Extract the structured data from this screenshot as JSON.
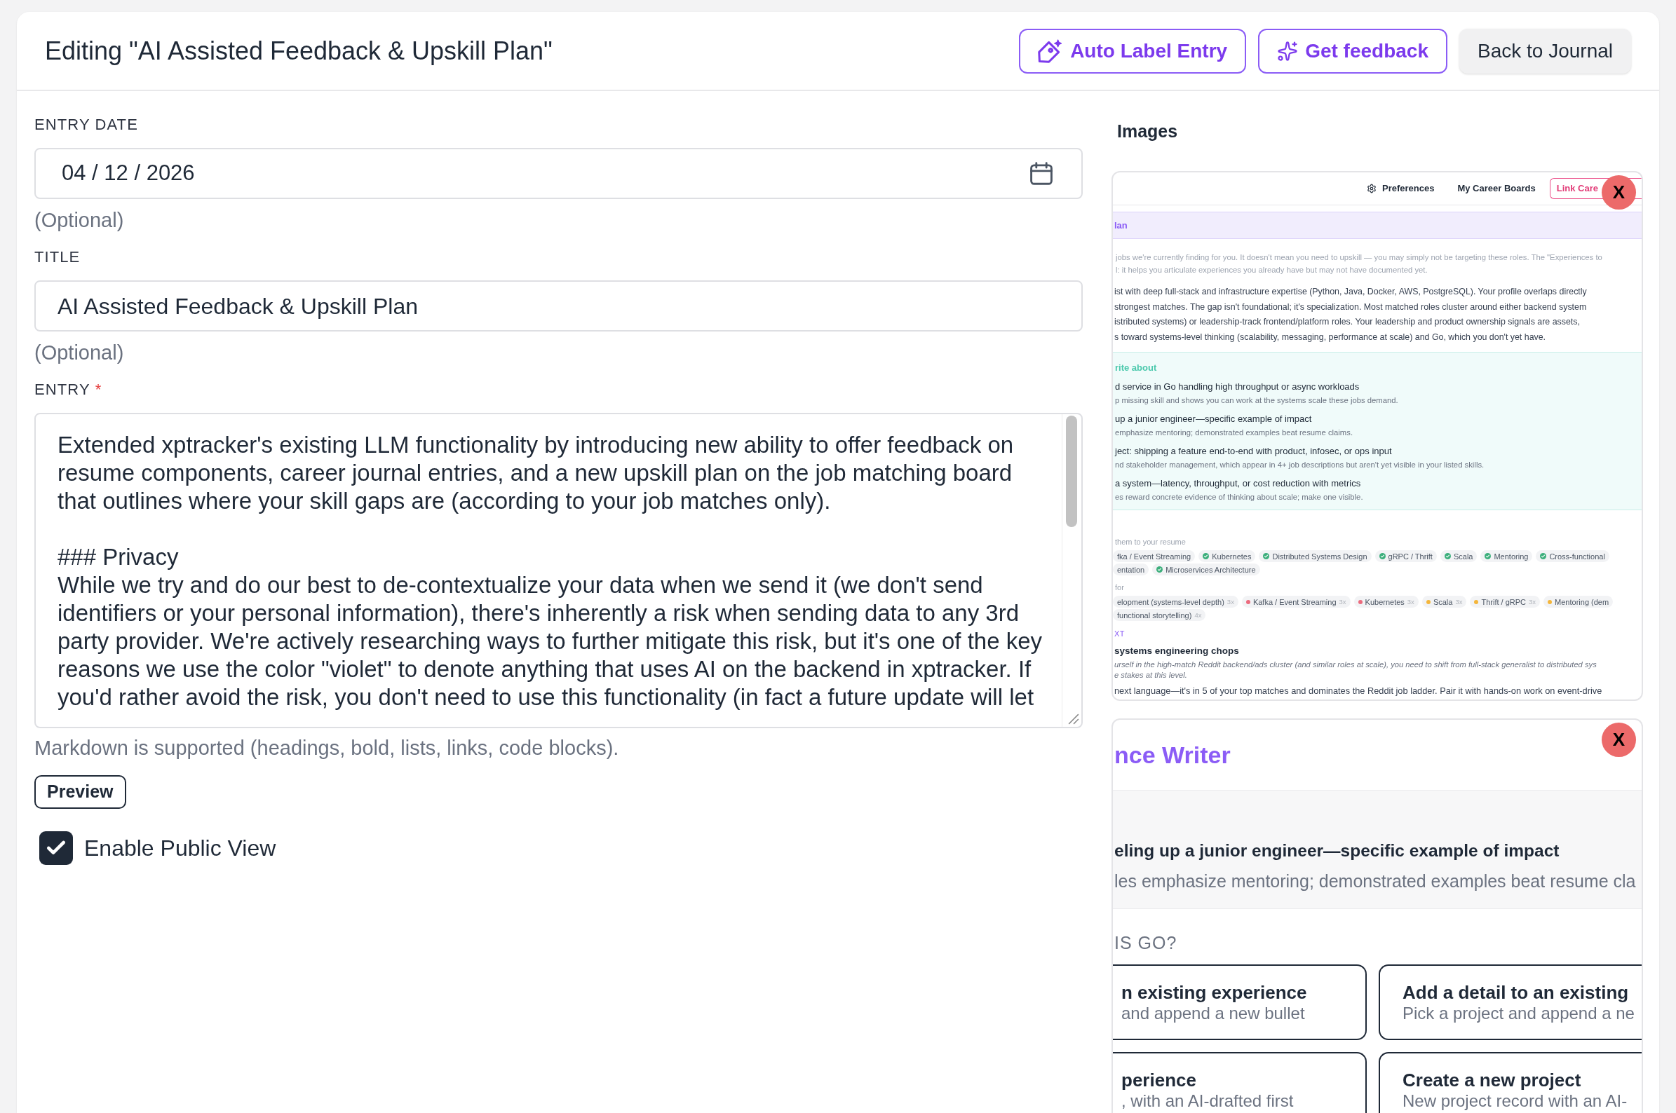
{
  "header": {
    "title": "Editing \"AI Assisted Feedback & Upskill Plan\"",
    "buttons": [
      {
        "kind": "label",
        "label": "Auto Label Entry"
      },
      {
        "kind": "feedback",
        "label": "Get feedback"
      },
      {
        "kind": "back",
        "label": "Back to Journal"
      }
    ]
  },
  "form": {
    "fields": [
      {
        "kind": "date",
        "label": "ENTRY DATE",
        "value": "04 / 12 / 2026",
        "hint": "(Optional)"
      },
      {
        "kind": "text",
        "label": "TITLE",
        "value": "AI Assisted Feedback & Upskill Plan",
        "hint": "(Optional)"
      },
      {
        "kind": "markdown",
        "label": "ENTRY",
        "required_mark": "*",
        "paragraphs": [
          [
            "Extended xptracker's existing LLM functionality by introducing new ability to offer feedback on",
            "resume components, career journal entries, and a new upskill plan on the job matching board",
            "that outlines where your skill gaps are (according to your job matches only)."
          ],
          [
            "### Privacy",
            "While we try and do our best to de-contextualize your data when we send it (we don't send",
            "identifiers or your personal information), there's inherently a risk when sending data to any 3rd",
            "party provider. We're actively researching ways to further mitigate this risk, but it's one of the key",
            "reasons we use the color \"violet\" to denote anything that uses AI on the backend in xptracker. If",
            "you'd rather avoid the risk, you don't need to use this functionality (in fact a future update will let"
          ]
        ],
        "hint": "Markdown is supported (headings, bold, lists, links, code blocks)."
      }
    ],
    "preview_button": "Preview",
    "public_view": {
      "label": "Enable Public View",
      "checked": true
    }
  },
  "images": {
    "title": "Images",
    "items": [
      {
        "kind": "upskill_plan",
        "remove_label": "X",
        "nav": [
          {
            "kind": "settings",
            "label": "Preferences"
          },
          {
            "kind": "link",
            "label": "My Career Boards"
          },
          {
            "kind": "outline",
            "label": "Link Care"
          }
        ],
        "banner": "lan",
        "intro_lines": [
          "jobs we're currently finding for you. It doesn't mean you need to upskill — you may simply not be targeting these roles. The \"Experiences to",
          "l: it helps you articulate experiences you already have but may not have documented yet."
        ],
        "summary_lines": [
          "ist with deep full-stack and infrastructure expertise (Python, Java, Docker, AWS, PostgreSQL). Your profile overlaps directly",
          "strongest matches. The gap isn't foundational; it's specialization. Most matched roles cluster around either backend system",
          "istributed systems) or leadership-track frontend/platform roles. Your leadership and product ownership signals are assets,",
          "s toward systems-level thinking (scalability, messaging, performance at scale) and Go, which you don't yet have."
        ],
        "write_about": {
          "heading": "rite about",
          "items": [
            {
              "title": "d service in Go handling high throughput or async workloads",
              "description": "p missing skill and shows you can work at the systems scale these jobs demand."
            },
            {
              "title": "up a junior engineer—specific example of impact",
              "description": "emphasize mentoring; demonstrated examples beat resume claims."
            },
            {
              "title": "ject: shipping a feature end-to-end with product, infosec, or ops input",
              "description": "nd stakeholder management, which appear in 4+ job descriptions but aren't yet visible in your listed skills."
            },
            {
              "title": "a system—latency, throughput, or cost reduction with metrics",
              "description": "es reward concrete evidence of thinking about scale; make one visible."
            }
          ]
        },
        "tag_groups": [
          {
            "heading": "them to your resume",
            "rows": [
              [
                {
                  "kind": "plain",
                  "label": "fka / Event Streaming"
                },
                {
                  "kind": "check",
                  "label": "Kubernetes"
                },
                {
                  "kind": "check",
                  "label": "Distributed Systems Design"
                },
                {
                  "kind": "check",
                  "label": "gRPC / Thrift"
                },
                {
                  "kind": "check",
                  "label": "Scala"
                },
                {
                  "kind": "check",
                  "label": "Mentoring"
                },
                {
                  "kind": "check",
                  "label": "Cross-functional"
                }
              ],
              [
                {
                  "kind": "plain",
                  "label": "entation"
                },
                {
                  "kind": "check",
                  "label": "Microservices Architecture"
                }
              ]
            ]
          },
          {
            "heading": "for",
            "rows": [
              [
                {
                  "kind": "plain",
                  "label": "elopment (systems-level depth)",
                  "count": "3x"
                },
                {
                  "kind": "dot",
                  "label": "Kafka / Event Streaming",
                  "count": "3x",
                  "color": "#ec6b7e"
                },
                {
                  "kind": "dot",
                  "label": "Kubernetes",
                  "count": "3x",
                  "color": "#ec6b7e"
                },
                {
                  "kind": "dot",
                  "label": "Scala",
                  "count": "3x",
                  "color": "#f4b63c"
                },
                {
                  "kind": "dot",
                  "label": "Thrift / gRPC",
                  "count": "3x",
                  "color": "#f4b63c"
                },
                {
                  "kind": "dot",
                  "label": "Mentoring (dem",
                  "color": "#f4b63c"
                }
              ],
              [
                {
                  "kind": "plain",
                  "label": "functional storytelling)",
                  "count": "4x"
                }
              ]
            ]
          }
        ],
        "next": {
          "heading": "XT",
          "title": "systems engineering chops",
          "note_lines": [
            "urself in the high-match Reddit backend/ads cluster (and similar roles at scale), you need to shift from full-stack generalist to distributed sys",
            "e stakes at this level."
          ],
          "text": "next language—it's in 5 of your top matches and dominates the Reddit job ladder. Pair it with hands-on work on event-drive"
        }
      },
      {
        "kind": "experience_writer",
        "remove_label": "X",
        "title": "nce Writer",
        "suggestion": {
          "title": "eling up a junior engineer—specific example of impact",
          "description": "les emphasize mentoring; demonstrated examples beat resume cla"
        },
        "question": "IS GO?",
        "options": [
          {
            "title": "n existing experience",
            "description": "and append a new bullet"
          },
          {
            "title": "Add a detail to an existing",
            "description": "Pick a project and append a ne"
          },
          {
            "title": "perience",
            "description": ", with an AI-drafted first"
          },
          {
            "title": "Create a new project",
            "description": "New project record with an AI-"
          }
        ]
      }
    ]
  }
}
